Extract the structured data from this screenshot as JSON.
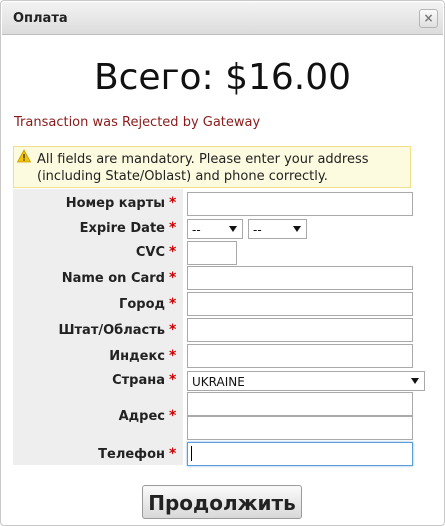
{
  "dialog": {
    "title": "Оплата",
    "close_glyph": "×"
  },
  "total": "Всего: $16.00",
  "error_message": "Transaction was Rejected by Gateway",
  "notice": {
    "icon": "warning-icon",
    "text": "All fields are mandatory. Please enter your address (including State/Oblast) and phone correctly."
  },
  "required_mark": "*",
  "fields": {
    "card_number": {
      "label": "Номер карты",
      "value": ""
    },
    "expire_date": {
      "label": "Expire Date",
      "month": "--",
      "year": "--"
    },
    "cvc": {
      "label": "CVC",
      "value": ""
    },
    "name_on_card": {
      "label": "Name on Card",
      "value": ""
    },
    "city": {
      "label": "Город",
      "value": ""
    },
    "state": {
      "label": "Штат/Область",
      "value": ""
    },
    "zip": {
      "label": "Индекс",
      "value": ""
    },
    "country": {
      "label": "Страна",
      "value": "UKRAINE"
    },
    "address": {
      "label": "Адрес",
      "line1": "",
      "line2": ""
    },
    "phone": {
      "label": "Телефон",
      "value": ""
    }
  },
  "submit_label": "Продолжить",
  "colors": {
    "error": "#8b1a1a",
    "required": "#cc0000",
    "notice_bg": "#fcfbe0",
    "label_bg": "#eeeeee"
  }
}
